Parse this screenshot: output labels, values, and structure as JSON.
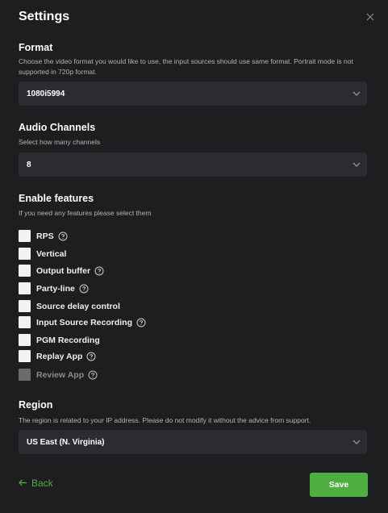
{
  "dialog": {
    "title": "Settings",
    "close_icon": "close-icon"
  },
  "format": {
    "title": "Format",
    "description": "Choose the video format you would like to use, the input sources should use same format. Portrait mode is not supported in 720p format.",
    "value": "1080i5994"
  },
  "audio_channels": {
    "title": "Audio Channels",
    "description": "Select how many channels",
    "value": "8"
  },
  "features": {
    "title": "Enable features",
    "description": "If you need any features please select them",
    "items": [
      {
        "label": "RPS",
        "help": true,
        "checked": false,
        "disabled": false
      },
      {
        "label": "Vertical",
        "help": false,
        "checked": false,
        "disabled": false
      },
      {
        "label": "Output buffer",
        "help": true,
        "checked": false,
        "disabled": false
      },
      {
        "label": "Party-line",
        "help": true,
        "checked": false,
        "disabled": false
      },
      {
        "label": "Source delay control",
        "help": false,
        "checked": false,
        "disabled": false
      },
      {
        "label": "Input Source Recording",
        "help": true,
        "checked": false,
        "disabled": false
      },
      {
        "label": "PGM Recording",
        "help": false,
        "checked": false,
        "disabled": false
      },
      {
        "label": "Replay App",
        "help": true,
        "checked": false,
        "disabled": false
      },
      {
        "label": "Review App",
        "help": true,
        "checked": false,
        "disabled": true
      }
    ]
  },
  "region": {
    "title": "Region",
    "description": "The region is related to your IP address. Please do not modify it without the advice from support.",
    "value": "US East (N. Virginia)"
  },
  "footer": {
    "back_label": "Back",
    "save_label": "Save"
  },
  "colors": {
    "background": "#1e1e20",
    "field": "#2b2c2f",
    "accent": "#4caf3e"
  }
}
